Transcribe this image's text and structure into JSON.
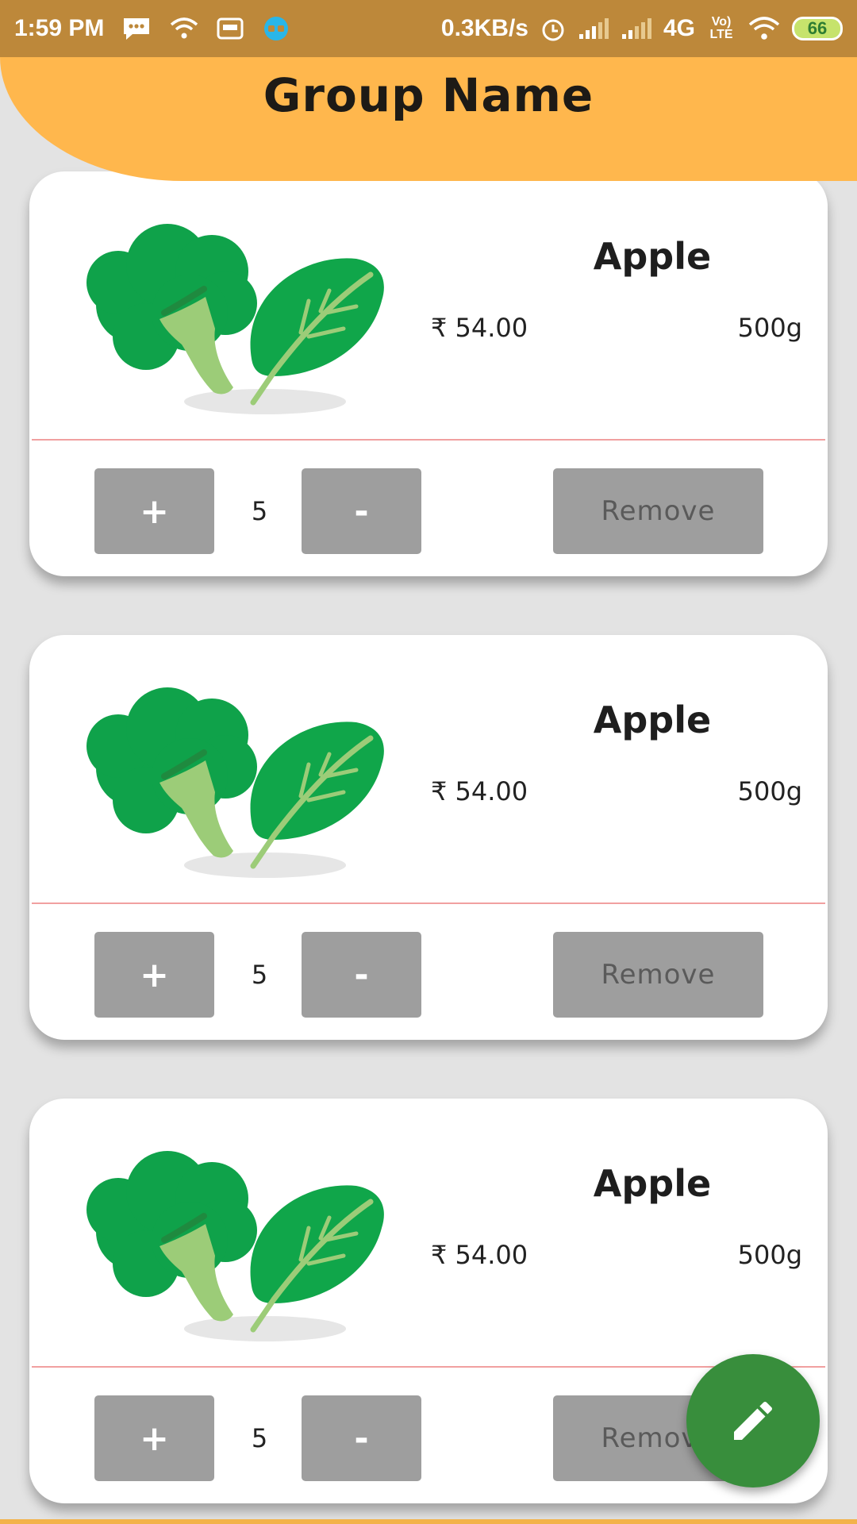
{
  "status_bar": {
    "time": "1:59 PM",
    "net_speed": "0.3KB/s",
    "network": "4G",
    "volte": "Vo) LTE",
    "battery": "66",
    "icons": [
      "message-icon",
      "wifi-icon",
      "cassette-icon",
      "vpn-icon",
      "alarm-icon",
      "signal-icon",
      "signal-icon",
      "wifi-icon"
    ]
  },
  "header": {
    "title": "Group Name",
    "color": "#ffb74d"
  },
  "products": [
    {
      "name": "Apple",
      "price": "₹ 54.00",
      "weight": "500g",
      "quantity": "5",
      "plus_label": "+",
      "minus_label": "-",
      "remove_label": "Remove"
    },
    {
      "name": "Apple",
      "price": "₹ 54.00",
      "weight": "500g",
      "quantity": "5",
      "plus_label": "+",
      "minus_label": "-",
      "remove_label": "Remove"
    },
    {
      "name": "Apple",
      "price": "₹ 54.00",
      "weight": "500g",
      "quantity": "5",
      "plus_label": "+",
      "minus_label": "-",
      "remove_label": "Remove"
    }
  ],
  "fab": {
    "icon": "pencil-icon",
    "color": "#388e3c"
  }
}
